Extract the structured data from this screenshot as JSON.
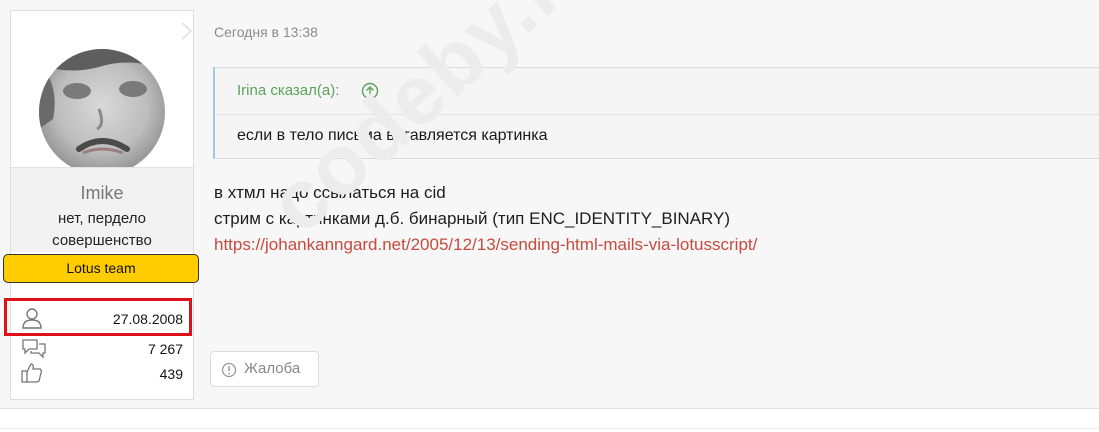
{
  "post": {
    "date": "Сегодня в 13:38",
    "quote": {
      "author": "Irina сказал(а):",
      "text": "если в тело письма вставляется картинка"
    },
    "message_lines": [
      "в хтмл надо ссылаться на cid",
      "стрим с картинками д.б. бинарный (тип ENC_IDENTITY_BINARY)"
    ],
    "link": "https://johankanngard.net/2005/12/13/sending-html-mails-via-lotusscript/",
    "report_label": "Жалоба"
  },
  "user": {
    "name": "Imike",
    "title_line1": "нет, пердело",
    "title_line2": "совершенство",
    "banner": "Lotus team",
    "joined": "27.08.2008",
    "messages": "7 267",
    "reactions": "439"
  },
  "watermark": "codeby.net",
  "icons": {
    "joined": "user-icon",
    "messages": "chat-bubbles-icon",
    "reactions": "thumbs-up-icon",
    "quote_jump": "arrow-up-circle-icon",
    "report": "info-circle-icon"
  },
  "colors": {
    "banner_bg": "#ffcc00",
    "quote_author": "#5aa35a",
    "quote_border": "#9fcbe8",
    "link": "#c64b3e",
    "highlight": "#e0101a"
  }
}
